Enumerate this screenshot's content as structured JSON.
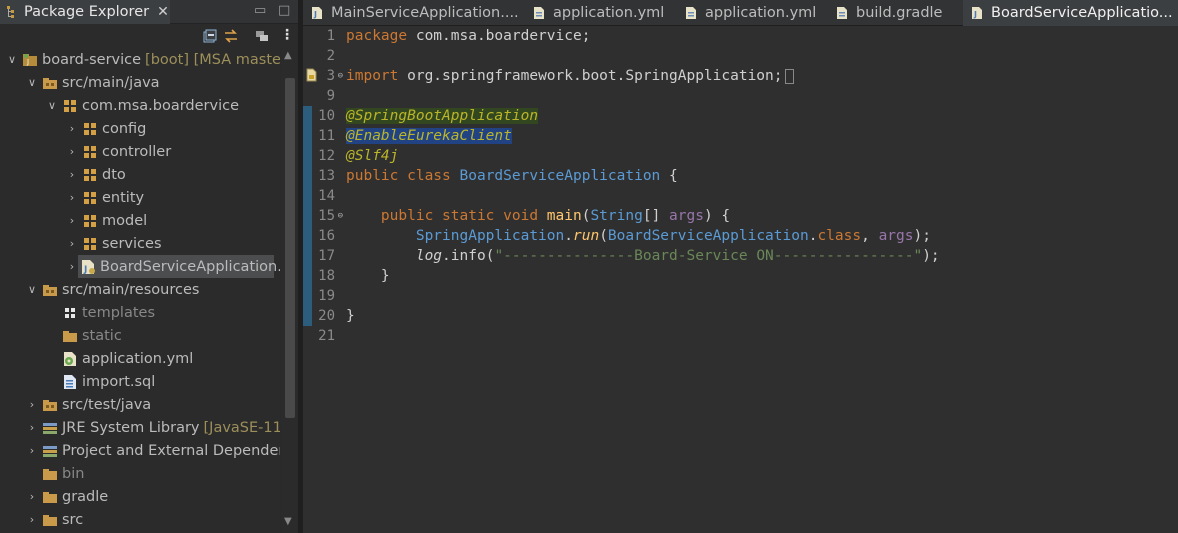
{
  "package_explorer": {
    "tab_title": "Package Explorer",
    "tab_close": "✕",
    "minimize": "▭",
    "maximize": "□",
    "items": [
      {
        "label": "board-service",
        "decoration": "[boot] [MSA master]",
        "indent": 0,
        "arrow": "∨",
        "icon": "project-icon"
      },
      {
        "label": "src/main/java",
        "decoration": "",
        "indent": 1,
        "arrow": "∨",
        "icon": "source-folder-icon"
      },
      {
        "label": "com.msa.boardervice",
        "decoration": "",
        "indent": 2,
        "arrow": "∨",
        "icon": "package-icon"
      },
      {
        "label": "config",
        "decoration": "",
        "indent": 3,
        "arrow": "›",
        "icon": "package-icon"
      },
      {
        "label": "controller",
        "decoration": "",
        "indent": 3,
        "arrow": "›",
        "icon": "package-icon"
      },
      {
        "label": "dto",
        "decoration": "",
        "indent": 3,
        "arrow": "›",
        "icon": "package-icon"
      },
      {
        "label": "entity",
        "decoration": "",
        "indent": 3,
        "arrow": "›",
        "icon": "package-icon"
      },
      {
        "label": "model",
        "decoration": "",
        "indent": 3,
        "arrow": "›",
        "icon": "package-icon"
      },
      {
        "label": "services",
        "decoration": "",
        "indent": 3,
        "arrow": "›",
        "icon": "package-icon"
      },
      {
        "label": "BoardServiceApplication.j",
        "decoration": "",
        "indent": 3,
        "arrow": "›",
        "icon": "java-file-icon",
        "selected": true
      },
      {
        "label": "src/main/resources",
        "decoration": "",
        "indent": 1,
        "arrow": "∨",
        "icon": "source-folder-icon"
      },
      {
        "label": "templates",
        "decoration": "",
        "indent": 2,
        "arrow": "",
        "icon": "empty-package-icon",
        "dim": true
      },
      {
        "label": "static",
        "decoration": "",
        "indent": 2,
        "arrow": "",
        "icon": "folder-icon",
        "dim": true
      },
      {
        "label": "application.yml",
        "decoration": "",
        "indent": 2,
        "arrow": "",
        "icon": "yml-file-icon"
      },
      {
        "label": "import.sql",
        "decoration": "",
        "indent": 2,
        "arrow": "",
        "icon": "sql-file-icon"
      },
      {
        "label": "src/test/java",
        "decoration": "",
        "indent": 1,
        "arrow": "›",
        "icon": "source-folder-icon"
      },
      {
        "label": "JRE System Library",
        "decoration": "[JavaSE-11]",
        "indent": 1,
        "arrow": "›",
        "icon": "library-icon"
      },
      {
        "label": "Project and External Dependen",
        "decoration": "",
        "indent": 1,
        "arrow": "›",
        "icon": "library-icon"
      },
      {
        "label": "bin",
        "decoration": "",
        "indent": 1,
        "arrow": "",
        "icon": "folder-icon",
        "dim": true
      },
      {
        "label": "gradle",
        "decoration": "",
        "indent": 1,
        "arrow": "›",
        "icon": "folder-icon"
      },
      {
        "label": "src",
        "decoration": "",
        "indent": 1,
        "arrow": "›",
        "icon": "folder-icon"
      }
    ]
  },
  "editor": {
    "tabs": [
      {
        "label": "MainServiceApplication....",
        "active": false
      },
      {
        "label": "application.yml",
        "active": false
      },
      {
        "label": "application.yml",
        "active": false
      },
      {
        "label": "build.gradle",
        "active": false
      },
      {
        "label": "BoardServiceApplicatio...",
        "active": true,
        "close": "✕"
      }
    ],
    "line_numbers": [
      "1",
      "2",
      "3",
      "9",
      "10",
      "11",
      "12",
      "13",
      "14",
      "15",
      "16",
      "17",
      "18",
      "19",
      "20",
      "21"
    ],
    "code": {
      "l1_kw": "package",
      "l1_rest": " com.msa.boardervice;",
      "l3_kw": "import",
      "l3_rest": " org.springframework.boot.SpringApplication;",
      "l10": "@SpringBootApplication",
      "l11": "@EnableEurekaClient",
      "l12": "@Slf4j",
      "l13_kw": "public class",
      "l13_cls": "BoardServiceApplication",
      "l13_rest": " {",
      "l15_kw": "public static void",
      "l15_mth": "main",
      "l15_type": "String",
      "l15_par": "args",
      "l16_cls": "SpringApplication",
      "l16_mth": "run",
      "l16_arg": "BoardServiceApplication",
      "l16_kw": "class",
      "l16_par": "args",
      "l17_log": "log",
      "l17_info": "info",
      "l17_str": "\"---------------Board-Service ON----------------\"",
      "l18": "}",
      "l20": "}"
    }
  }
}
